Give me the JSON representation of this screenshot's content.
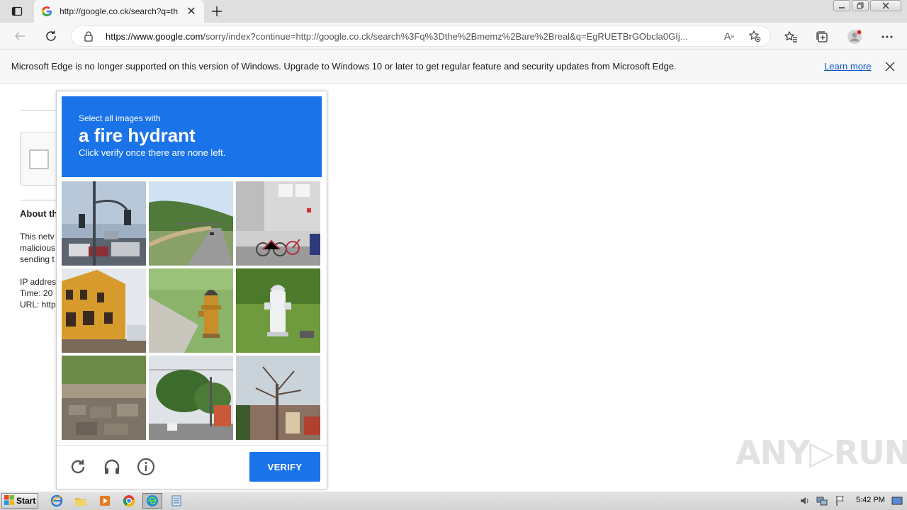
{
  "browser": {
    "tab_title": "http://google.co.ck/search?q=th",
    "tab_close": "✕",
    "url_host": "https://www.google.com",
    "url_rest": "/sorry/index?continue=http://google.co.ck/search%3Fq%3Dthe%2Bmemz%2Bare%2Breal&q=EgRUETBrGObcla0GIj...",
    "read_aloud": "A",
    "read_aloud_sup": "»"
  },
  "infobar": {
    "message": "Microsoft Edge is no longer supported on this version of Windows. Upgrade to Windows 10 or later to get regular feature and security updates from Microsoft Edge.",
    "learn_more": "Learn more"
  },
  "sorry_page": {
    "about_heading": "About th",
    "line1": "This netv",
    "line2": "malicious",
    "line3": "sending t",
    "ip": "IP addres",
    "time": "Time: 20",
    "url": "URL: http"
  },
  "challenge": {
    "instruction": "Select all images with",
    "target": "a fire hydrant",
    "hint": "Click verify once there are none left.",
    "verify_label": "VERIFY",
    "tiles": [
      "traffic-lights-intersection",
      "highway-road",
      "bicycles-by-building",
      "yellow-building",
      "yellow-fire-hydrant",
      "white-fire-hydrant",
      "stone-wall",
      "street-with-trees",
      "bare-tree-street"
    ]
  },
  "watermark": {
    "text": "ANY▷RUN"
  },
  "taskbar": {
    "start_label": "Start",
    "clock": "5:42 PM"
  },
  "colors": {
    "recaptcha_blue": "#1a73e8",
    "link_blue": "#0b57d0"
  }
}
